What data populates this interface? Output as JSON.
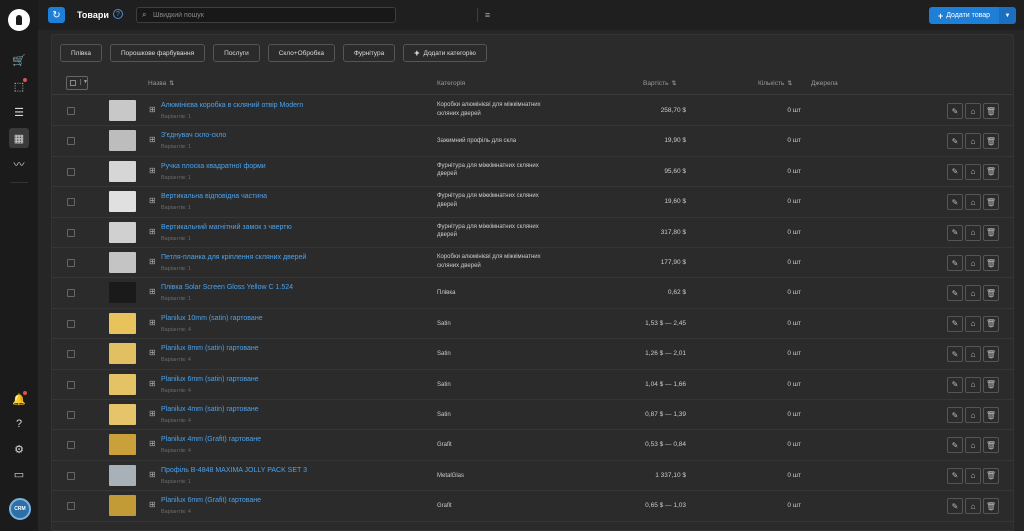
{
  "sidebar": {
    "avatar_text": "CRM",
    "items": [
      {
        "icon": "cart-icon",
        "glyph": "🛒",
        "badge": false
      },
      {
        "icon": "orders-icon",
        "glyph": "⬚",
        "badge": true
      },
      {
        "icon": "tasks-list-icon",
        "glyph": "☰",
        "badge": false
      },
      {
        "icon": "products-icon",
        "glyph": "▦",
        "badge": false,
        "active": true
      },
      {
        "icon": "analytics-icon",
        "glyph": "〰",
        "badge": false
      }
    ],
    "bottom_items": [
      {
        "icon": "bell-icon",
        "glyph": "🔔",
        "badge": true
      },
      {
        "icon": "help-icon",
        "glyph": "?",
        "badge": false
      },
      {
        "icon": "settings-icon",
        "glyph": "⚙",
        "badge": false
      },
      {
        "icon": "wallet-icon",
        "glyph": "▭",
        "badge": false
      }
    ]
  },
  "header": {
    "refresh_icon": "refresh-icon",
    "title": "Товари",
    "help_glyph": "?",
    "search_placeholder": "Швидкий пошук",
    "add_button_label": "Додати товар"
  },
  "categories": [
    "Плівка",
    "Порошкове фарбування",
    "Послуги",
    "Скло+Обробка",
    "Фурнітура"
  ],
  "add_category_label": "Додати категорію",
  "columns": {
    "name": "Назва",
    "category": "Категорія",
    "price": "Вартість",
    "quantity": "Кількість",
    "source": "Джерела"
  },
  "rows": [
    {
      "name": "Алюмінієва коробка в скляний отвір Modern",
      "variants": "Варіантів: 1",
      "category": "Коробки алюмінієві для міжкімнатних скляних дверей",
      "price": "258,70 $",
      "qty": "0 шт",
      "thumb": "#c8c8c8"
    },
    {
      "name": "З'єднувач скло-скло",
      "variants": "Варіантів: 1",
      "category": "Зажимний профіль для скла",
      "price": "19,90 $",
      "qty": "0 шт",
      "thumb": "#bdbdbd"
    },
    {
      "name": "Ручка плоска квадратної форми",
      "variants": "Варіантів: 1",
      "category": "Фурнітура для міжкімнатних скляних дверей",
      "price": "95,60 $",
      "qty": "0 шт",
      "thumb": "#d6d6d6"
    },
    {
      "name": "Вертикальна відповідна частина",
      "variants": "Варіантів: 1",
      "category": "Фурнітура для міжкімнатних скляних дверей",
      "price": "19,60 $",
      "qty": "0 шт",
      "thumb": "#e0e0e0"
    },
    {
      "name": "Вертикальний магнітний замок з чвертю",
      "variants": "Варіантів: 1",
      "category": "Фурнітура для міжкімнатних скляних дверей",
      "price": "317,80 $",
      "qty": "0 шт",
      "thumb": "#d0d0d0"
    },
    {
      "name": "Петля-планка для кріплення скляних дверей",
      "variants": "Варіантів: 1",
      "category": "Коробки алюмінієві для міжкімнатних скляних дверей",
      "price": "177,90 $",
      "qty": "0 шт",
      "thumb": "#c4c4c4"
    },
    {
      "name": "Плівка Solar Screen Gloss Yellow C 1.524",
      "variants": "Варіантів: 1",
      "category": "Плівка",
      "price": "0,62 $",
      "qty": "0 шт",
      "thumb": "#1a1a1a"
    },
    {
      "name": "Planilux 10mm (satin) гартоване",
      "variants": "Варіантів: 4",
      "category": "Satin",
      "price": "1,53 $ — 2,45",
      "qty": "0 шт",
      "thumb": "#e8c25a"
    },
    {
      "name": "Planilux 8mm (satin) гартоване",
      "variants": "Варіантів: 4",
      "category": "Satin",
      "price": "1,26 $ — 2,01",
      "qty": "0 шт",
      "thumb": "#e2bf60"
    },
    {
      "name": "Planilux 6mm (satin) гартоване",
      "variants": "Варіантів: 4",
      "category": "Satin",
      "price": "1,04 $ — 1,66",
      "qty": "0 шт",
      "thumb": "#e4c266"
    },
    {
      "name": "Planilux 4mm (satin) гартоване",
      "variants": "Варіантів: 4",
      "category": "Satin",
      "price": "0,87 $ — 1,39",
      "qty": "0 шт",
      "thumb": "#e6c46a"
    },
    {
      "name": "Planilux 4mm (Grafit) гартоване",
      "variants": "Варіантів: 4",
      "category": "Grafit",
      "price": "0,53 $ — 0,84",
      "qty": "0 шт",
      "thumb": "#c9a03a"
    },
    {
      "name": "Профіль В-4848 MAXIMA JOLLY PACK SET 3",
      "variants": "Варіантів: 1",
      "category": "MetalGlas",
      "price": "1 337,10 $",
      "qty": "0 шт",
      "thumb": "#a8b0b8"
    },
    {
      "name": "Planilux 6mm (Grafit) гартоване",
      "variants": "Варіантів: 4",
      "category": "Grafit",
      "price": "0,65 $ — 1,03",
      "qty": "0 шт",
      "thumb": "#c29a36"
    }
  ]
}
